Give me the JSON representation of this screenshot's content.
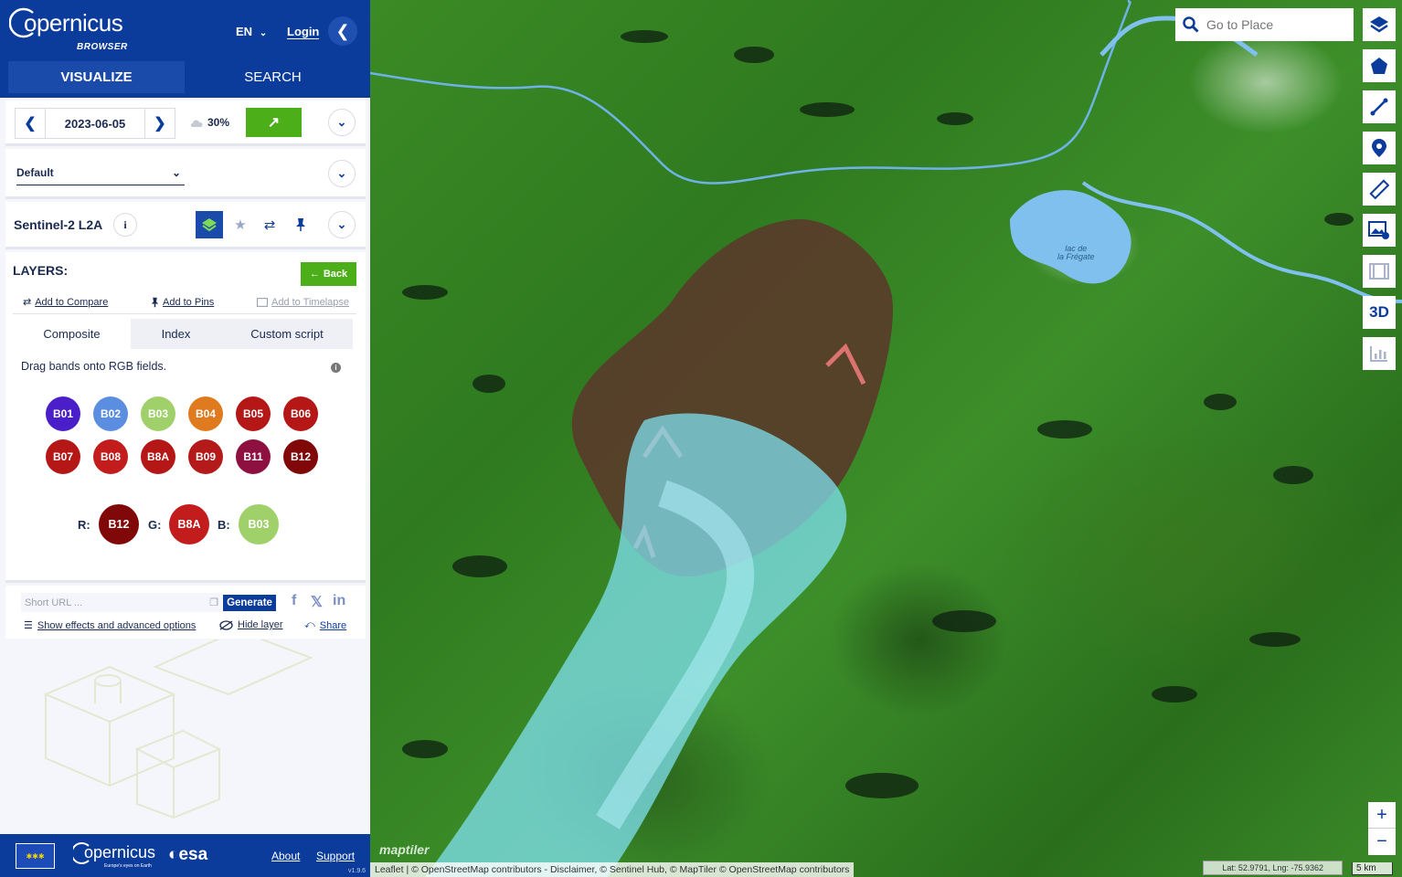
{
  "header": {
    "logo_text": "opernicus",
    "logo_sub": "BROWSER",
    "language": "EN",
    "login": "Login",
    "tabs": [
      {
        "label": "VISUALIZE"
      },
      {
        "label": "SEARCH"
      }
    ]
  },
  "date_bar": {
    "date": "2023-06-05",
    "cloud_coverage": "30%"
  },
  "theme": {
    "selected": "Default"
  },
  "datasource": {
    "title": "Sentinel-2 L2A",
    "info": "i"
  },
  "layers": {
    "title": "LAYERS:",
    "back_label": "Back",
    "actions": {
      "add_compare": "Add to Compare",
      "add_pins": "Add to Pins",
      "add_timelapse": "Add to Timelapse"
    },
    "subtabs": [
      {
        "label": "Composite"
      },
      {
        "label": "Index"
      },
      {
        "label": "Custom script"
      }
    ],
    "drag_text": "Drag bands onto RGB fields.",
    "bands": [
      {
        "label": "B01",
        "color": "#4a1ec8"
      },
      {
        "label": "B02",
        "color": "#5b8ee0"
      },
      {
        "label": "B03",
        "color": "#9fd06a"
      },
      {
        "label": "B04",
        "color": "#e07a1e"
      },
      {
        "label": "B05",
        "color": "#b51616"
      },
      {
        "label": "B06",
        "color": "#b51616"
      },
      {
        "label": "B07",
        "color": "#b51616"
      },
      {
        "label": "B08",
        "color": "#c21c1c"
      },
      {
        "label": "B8A",
        "color": "#b51616"
      },
      {
        "label": "B09",
        "color": "#b51a1a"
      },
      {
        "label": "B11",
        "color": "#8e1040"
      },
      {
        "label": "B12",
        "color": "#800808"
      }
    ],
    "rgb": {
      "r_label": "R:",
      "r_band": "B12",
      "r_color": "#800808",
      "g_label": "G:",
      "g_band": "B8A",
      "g_color": "#c21c1c",
      "b_label": "B:",
      "b_band": "B03",
      "b_color": "#9fd06a"
    }
  },
  "share": {
    "url_placeholder": "Short URL ...",
    "generate": "Generate",
    "effects": "Show effects and advanced options",
    "hide_layer": "Hide layer",
    "share": "Share"
  },
  "map": {
    "search_placeholder": "Go to Place",
    "lake_label_1": "lac de",
    "lake_label_2": "la Frégate",
    "attribution": "Leaflet | © OpenStreetMap contributors - Disclaimer, © Sentinel Hub, © MapTiler © OpenStreetMap contributors",
    "coords": "Lat: 52.9791, Lng: -75.9362",
    "scale": "5 km",
    "maptiler": "maptiler",
    "tool_3d": "3D",
    "zoom_in": "+",
    "zoom_out": "−"
  },
  "footer": {
    "copernicus": "opernicus",
    "copernicus_sub": "Europe's eyes on Earth",
    "esa": "esa",
    "about": "About",
    "support": "Support",
    "version": "v1.9.6"
  }
}
